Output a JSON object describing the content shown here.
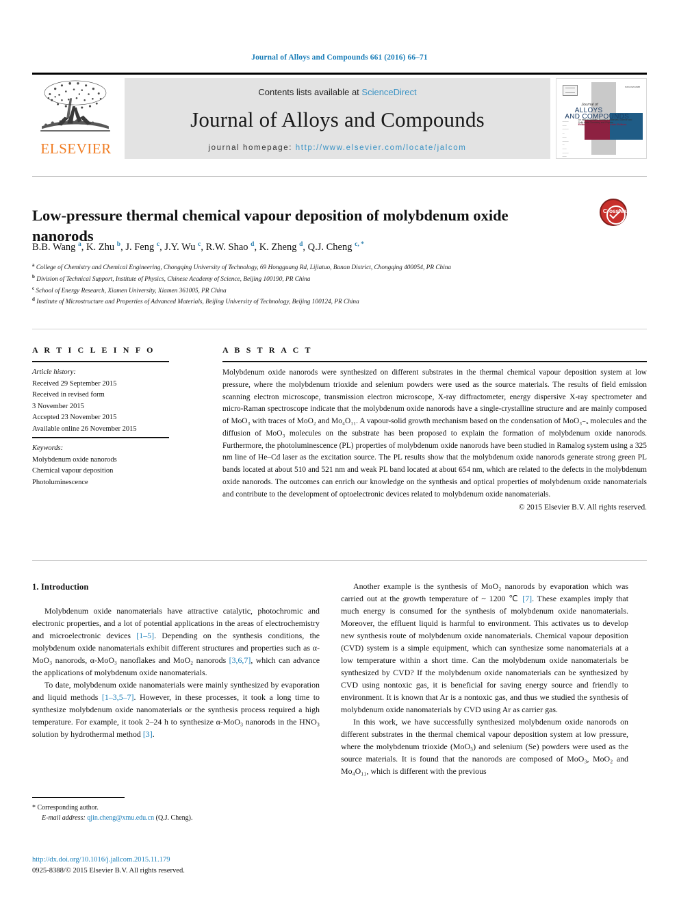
{
  "running_head": "Journal of Alloys and Compounds 661 (2016) 66–71",
  "masthead": {
    "contents_prefix": "Contents lists available at ",
    "sciencedirect": "ScienceDirect",
    "journal_title": "Journal of Alloys and Compounds",
    "homepage_label": "journal homepage:",
    "homepage_url": "http://www.elsevier.com/locate/jalcom",
    "publisher": "ELSEVIER",
    "publisher_color": "#f07c22",
    "link_color": "#3a92c4",
    "band_color": "#e3e3e3"
  },
  "cover": {
    "line1": "Journal of",
    "line2": "ALLOYS",
    "line3": "AND COMPOUNDS",
    "subtitle": "An Interdisciplinary Journal of Materials Science and Solid-state Chemistry and Physics",
    "editors": "Editor-in-Chief and Associate Editors",
    "top_right": "ISSN 0925-8388",
    "maroon": "#8d2141",
    "blue": "#1f5c86"
  },
  "crossmark": {
    "label": "CrossMark"
  },
  "title": "Low-pressure thermal chemical vapour deposition of molybdenum oxide nanorods",
  "authors": [
    {
      "name": "B.B. Wang",
      "marks": "a"
    },
    {
      "name": "K. Zhu",
      "marks": "b"
    },
    {
      "name": "J. Feng",
      "marks": "c"
    },
    {
      "name": "J.Y. Wu",
      "marks": "c"
    },
    {
      "name": "R.W. Shao",
      "marks": "d"
    },
    {
      "name": "K. Zheng",
      "marks": "d"
    },
    {
      "name": "Q.J. Cheng",
      "marks": "c, *"
    }
  ],
  "affiliations": [
    {
      "mark": "a",
      "text": "College of Chemistry and Chemical Engineering, Chongqing University of Technology, 69 Hongguang Rd, Lijiatuo, Banan District, Chongqing 400054, PR China"
    },
    {
      "mark": "b",
      "text": "Division of Technical Support, Institute of Physics, Chinese Academy of Science, Beijing 100190, PR China"
    },
    {
      "mark": "c",
      "text": "School of Energy Research, Xiamen University, Xiamen 361005, PR China"
    },
    {
      "mark": "d",
      "text": "Institute of Microstructure and Properties of Advanced Materials, Beijing University of Technology, Beijing 100124, PR China"
    }
  ],
  "article_info": {
    "heading": "A R T I C L E   I N F O",
    "history_label": "Article history:",
    "history": [
      "Received 29 September 2015",
      "Received in revised form",
      "3 November 2015",
      "Accepted 23 November 2015",
      "Available online 26 November 2015"
    ],
    "keywords_label": "Keywords:",
    "keywords": [
      "Molybdenum oxide nanorods",
      "Chemical vapour deposition",
      "Photoluminescence"
    ]
  },
  "abstract": {
    "heading": "A B S T R A C T",
    "text": "Molybdenum oxide nanorods were synthesized on different substrates in the thermal chemical vapour deposition system at low pressure, where the molybdenum trioxide and selenium powders were used as the source materials. The results of field emission scanning electron microscope, transmission electron microscope, X-ray diffractometer, energy dispersive X-ray spectrometer and micro-Raman spectroscope indicate that the molybdenum oxide nanorods have a single-crystalline structure and are mainly composed of MoO₃ with traces of MoO₂ and Mo₄O₁₁. A vapour-solid growth mechanism based on the condensation of MoO₃₋ₓ molecules and the diffusion of MoO₃ molecules on the substrate has been proposed to explain the formation of molybdenum oxide nanorods. Furthermore, the photoluminescence (PL) properties of molybdenum oxide nanorods have been studied in Ramalog system using a 325 nm line of He–Cd laser as the excitation source. The PL results show that the molybdenum oxide nanorods generate strong green PL bands located at about 510 and 521 nm and weak PL band located at about 654 nm, which are related to the defects in the molybdenum oxide nanorods. The outcomes can enrich our knowledge on the synthesis and optical properties of molybdenum oxide nanomaterials and contribute to the development of optoelectronic devices related to molybdenum oxide nanomaterials.",
    "copyright": "© 2015 Elsevier B.V. All rights reserved."
  },
  "body": {
    "section_heading": "1. Introduction",
    "left_paragraphs": [
      "Molybdenum oxide nanomaterials have attractive catalytic, photochromic and electronic properties, and a lot of potential applications in the areas of electrochemistry and microelectronic devices [1–5]. Depending on the synthesis conditions, the molybdenum oxide nanomaterials exhibit different structures and properties such as α-MoO₃ nanorods, α-MoO₃ nanoflakes and MoO₂ nanorods [3,6,7], which can advance the applications of molybdenum oxide nanomaterials.",
      "To date, molybdenum oxide nanomaterials were mainly synthesized by evaporation and liquid methods [1–3,5–7]. However, in these processes, it took a long time to synthesize molybdenum oxide nanomaterials or the synthesis process required a high temperature. For example, it took 2–24 h to synthesize α-MoO₃ nanorods in the HNO₃ solution by hydrothermal method [3]."
    ],
    "right_paragraphs": [
      "Another example is the synthesis of MoO₂ nanorods by evaporation which was carried out at the growth temperature of ~ 1200 ℃ [7]. These examples imply that much energy is consumed for the synthesis of molybdenum oxide nanomaterials. Moreover, the effluent liquid is harmful to environment. This activates us to develop new synthesis route of molybdenum oxide nanomaterials. Chemical vapour deposition (CVD) system is a simple equipment, which can synthesize some nanomaterials at a low temperature within a short time. Can the molybdenum oxide nanomaterials be synthesized by CVD? If the molybdenum oxide nanomaterials can be synthesized by CVD using nontoxic gas, it is beneficial for saving energy source and friendly to environment. It is known that Ar is a nontoxic gas, and thus we studied the synthesis of molybdenum oxide nanomaterials by CVD using Ar as carrier gas.",
      "In this work, we have successfully synthesized molybdenum oxide nanorods on different substrates in the thermal chemical vapour deposition system at low pressure, where the molybdenum trioxide (MoO₃) and selenium (Se) powders were used as the source materials. It is found that the nanorods are composed of MoO₃, MoO₂ and Mo₄O₁₁, which is different with the previous"
    ]
  },
  "footnote": {
    "star": "*",
    "corresponding": "Corresponding author.",
    "email_label": "E-mail address:",
    "email": "qjin.cheng@xmu.edu.cn",
    "email_person": "(Q.J. Cheng)."
  },
  "footer": {
    "doi": "http://dx.doi.org/10.1016/j.jallcom.2015.11.179",
    "issn_line": "0925-8388/© 2015 Elsevier B.V. All rights reserved."
  },
  "colors": {
    "link": "#1b7eb8",
    "accent_orange": "#f07c22",
    "crossmark_red": "#c8302c"
  }
}
